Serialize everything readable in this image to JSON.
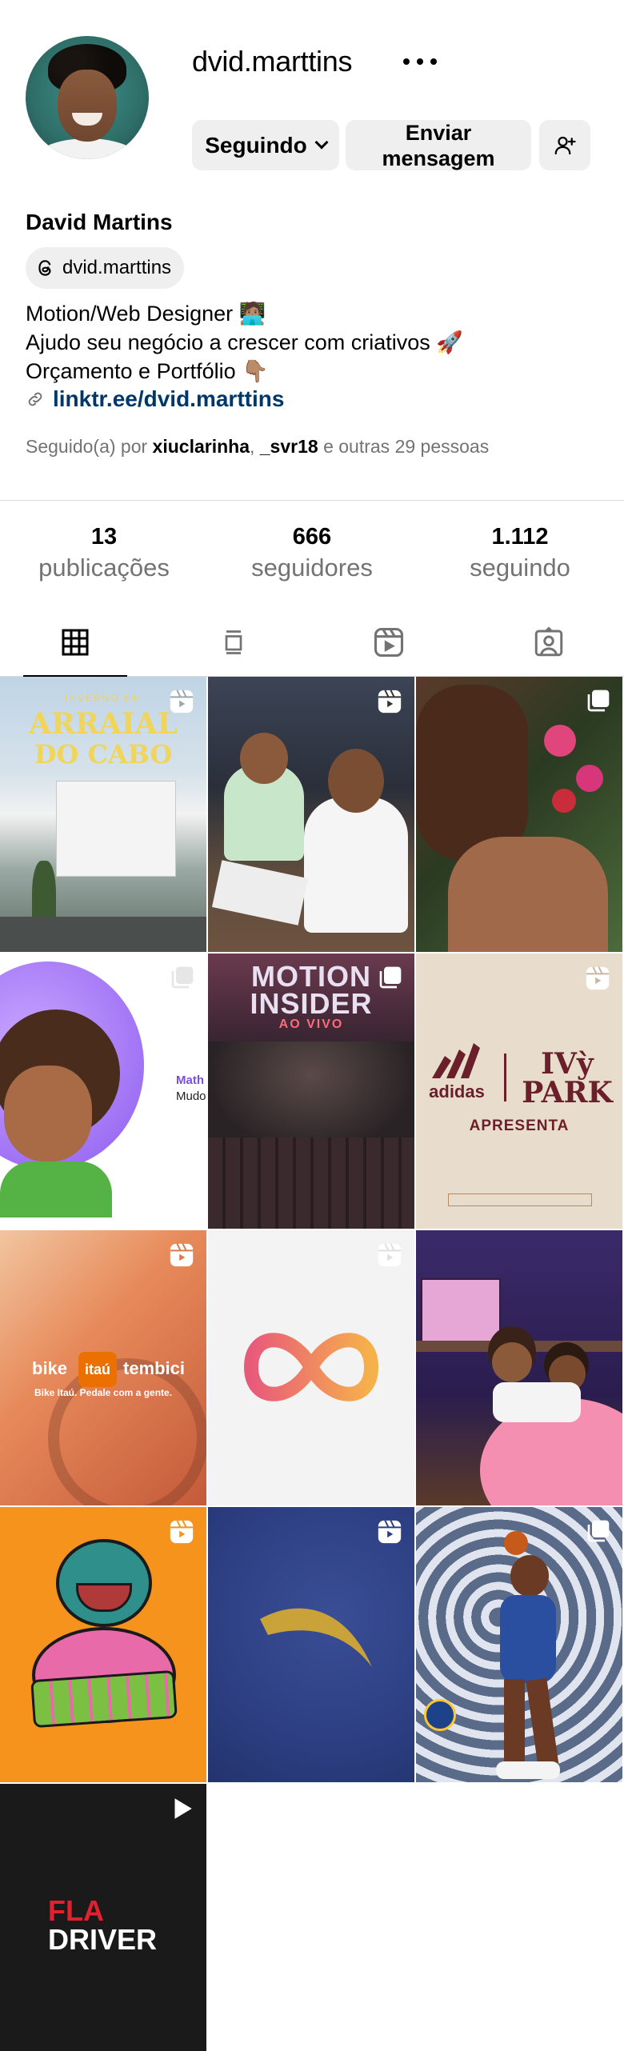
{
  "profile": {
    "username": "dvid.marttins",
    "full_name": "David Martins",
    "threads_handle": "dvid.marttins",
    "bio_lines": [
      "Motion/Web Designer 🧑🏽‍💻",
      "Ajudo seu negócio a crescer com criativos 🚀",
      "Orçamento e Portfólio 👇🏽"
    ],
    "link": "linktr.ee/dvid.marttins",
    "followed_by_prefix": "Seguido(a) por",
    "followed_by_user1": "xiuclarinha",
    "followed_by_sep": ",",
    "followed_by_user2": "_svr18",
    "followed_by_suffix": "e outras 29 pessoas"
  },
  "buttons": {
    "following": "Seguindo",
    "message": "Enviar mensagem"
  },
  "stats": [
    {
      "value": "13",
      "label": "publicações"
    },
    {
      "value": "666",
      "label": "seguidores"
    },
    {
      "value": "1.112",
      "label": "seguindo"
    }
  ],
  "tabs": [
    "grid-icon",
    "feed-icon",
    "reels-icon",
    "tagged-icon"
  ],
  "posts": {
    "p1": {
      "l1": "INVERNO EM",
      "l2": "ARRAIAL",
      "l3": "DO CABO"
    },
    "p5": {
      "l1": "MOTION",
      "l2": "INSIDER",
      "l3": "AO VIVO"
    },
    "p6": {
      "brand1": "adidas",
      "brand2": "IVỳ PARK",
      "sub": "APRESENTA"
    },
    "p7": {
      "w1": "bike",
      "w2": "itaú",
      "w3": "tembici",
      "tag": "Bike Itaú. Pedale com a gente."
    },
    "p4": {
      "l1": "Math",
      "l2": "Mudo"
    },
    "p13": {
      "l1": "FLA",
      "l2": "DRIVER"
    }
  },
  "colors": {
    "link": "#00376b",
    "button_bg": "#efefef",
    "muted": "#737373"
  }
}
